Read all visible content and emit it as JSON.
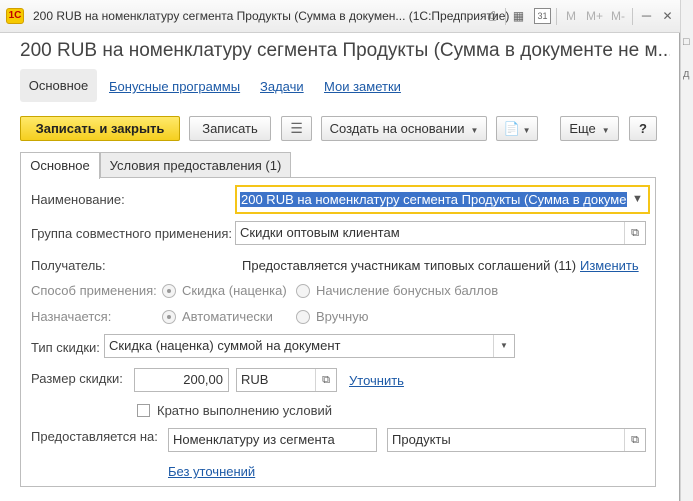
{
  "window": {
    "logo_text": "1С",
    "title": "200 RUB на номенклатуру сегмента Продукты (Сумма в докумен... (1С:Предприятие)",
    "toolbar_texts": {
      "m": "M",
      "m_plus": "M+",
      "m_minus": "M-"
    },
    "icons": [
      "printer-icon",
      "calculator-icon",
      "calendar-icon",
      "minimize-icon",
      "maximize-icon",
      "close-icon"
    ]
  },
  "header": {
    "title": "200 RUB на номенклатуру сегмента Продукты (Сумма в документе не м...",
    "nav_tabs": [
      {
        "label": "Основное",
        "active": true
      },
      {
        "label": "Бонусные программы",
        "active": false
      },
      {
        "label": "Задачи",
        "active": false
      },
      {
        "label": "Мои заметки",
        "active": false
      }
    ]
  },
  "toolbar": {
    "save_close": "Записать и закрыть",
    "save": "Записать",
    "create_based_on": "Создать на основании",
    "more": "Еще",
    "help": "?"
  },
  "panel_tabs": [
    "Основное",
    "Условия предоставления (1)"
  ],
  "form": {
    "name_label": "Наименование:",
    "name_value": "200 RUB на номенклатуру сегмента Продукты (Сумма в докуме",
    "group_label": "Группа совместного применения:",
    "group_value": "Скидки оптовым клиентам",
    "recipient_label": "Получатель:",
    "recipient_value": "Предоставляется участникам типовых соглашений (11)",
    "recipient_change": "Изменить",
    "method_label": "Способ применения:",
    "method_options": [
      "Скидка (наценка)",
      "Начисление бонусных баллов"
    ],
    "method_selected": "Скидка (наценка)",
    "assigned_label": "Назначается:",
    "assigned_options": [
      "Автоматически",
      "Вручную"
    ],
    "assigned_selected": "Автоматически",
    "discount_type_label": "Тип скидки:",
    "discount_type_value": "Скидка (наценка) суммой на документ",
    "discount_size_label": "Размер скидки:",
    "discount_size_value": "200,00",
    "currency_value": "RUB",
    "refine_link": "Уточнить",
    "multiple_checkbox_label": "Кратно выполнению условий",
    "multiple_checked": false,
    "provided_on_label": "Предоставляется на:",
    "provided_on_value": "Номенклатуру из сегмента",
    "segment_value": "Продукты",
    "no_refine_link": "Без уточнений"
  },
  "colors": {
    "accent_yellow": "#f5cf1f",
    "link_blue": "#1d5aa7",
    "selection_blue": "#3c73c9",
    "focus_border": "#f5c518"
  }
}
